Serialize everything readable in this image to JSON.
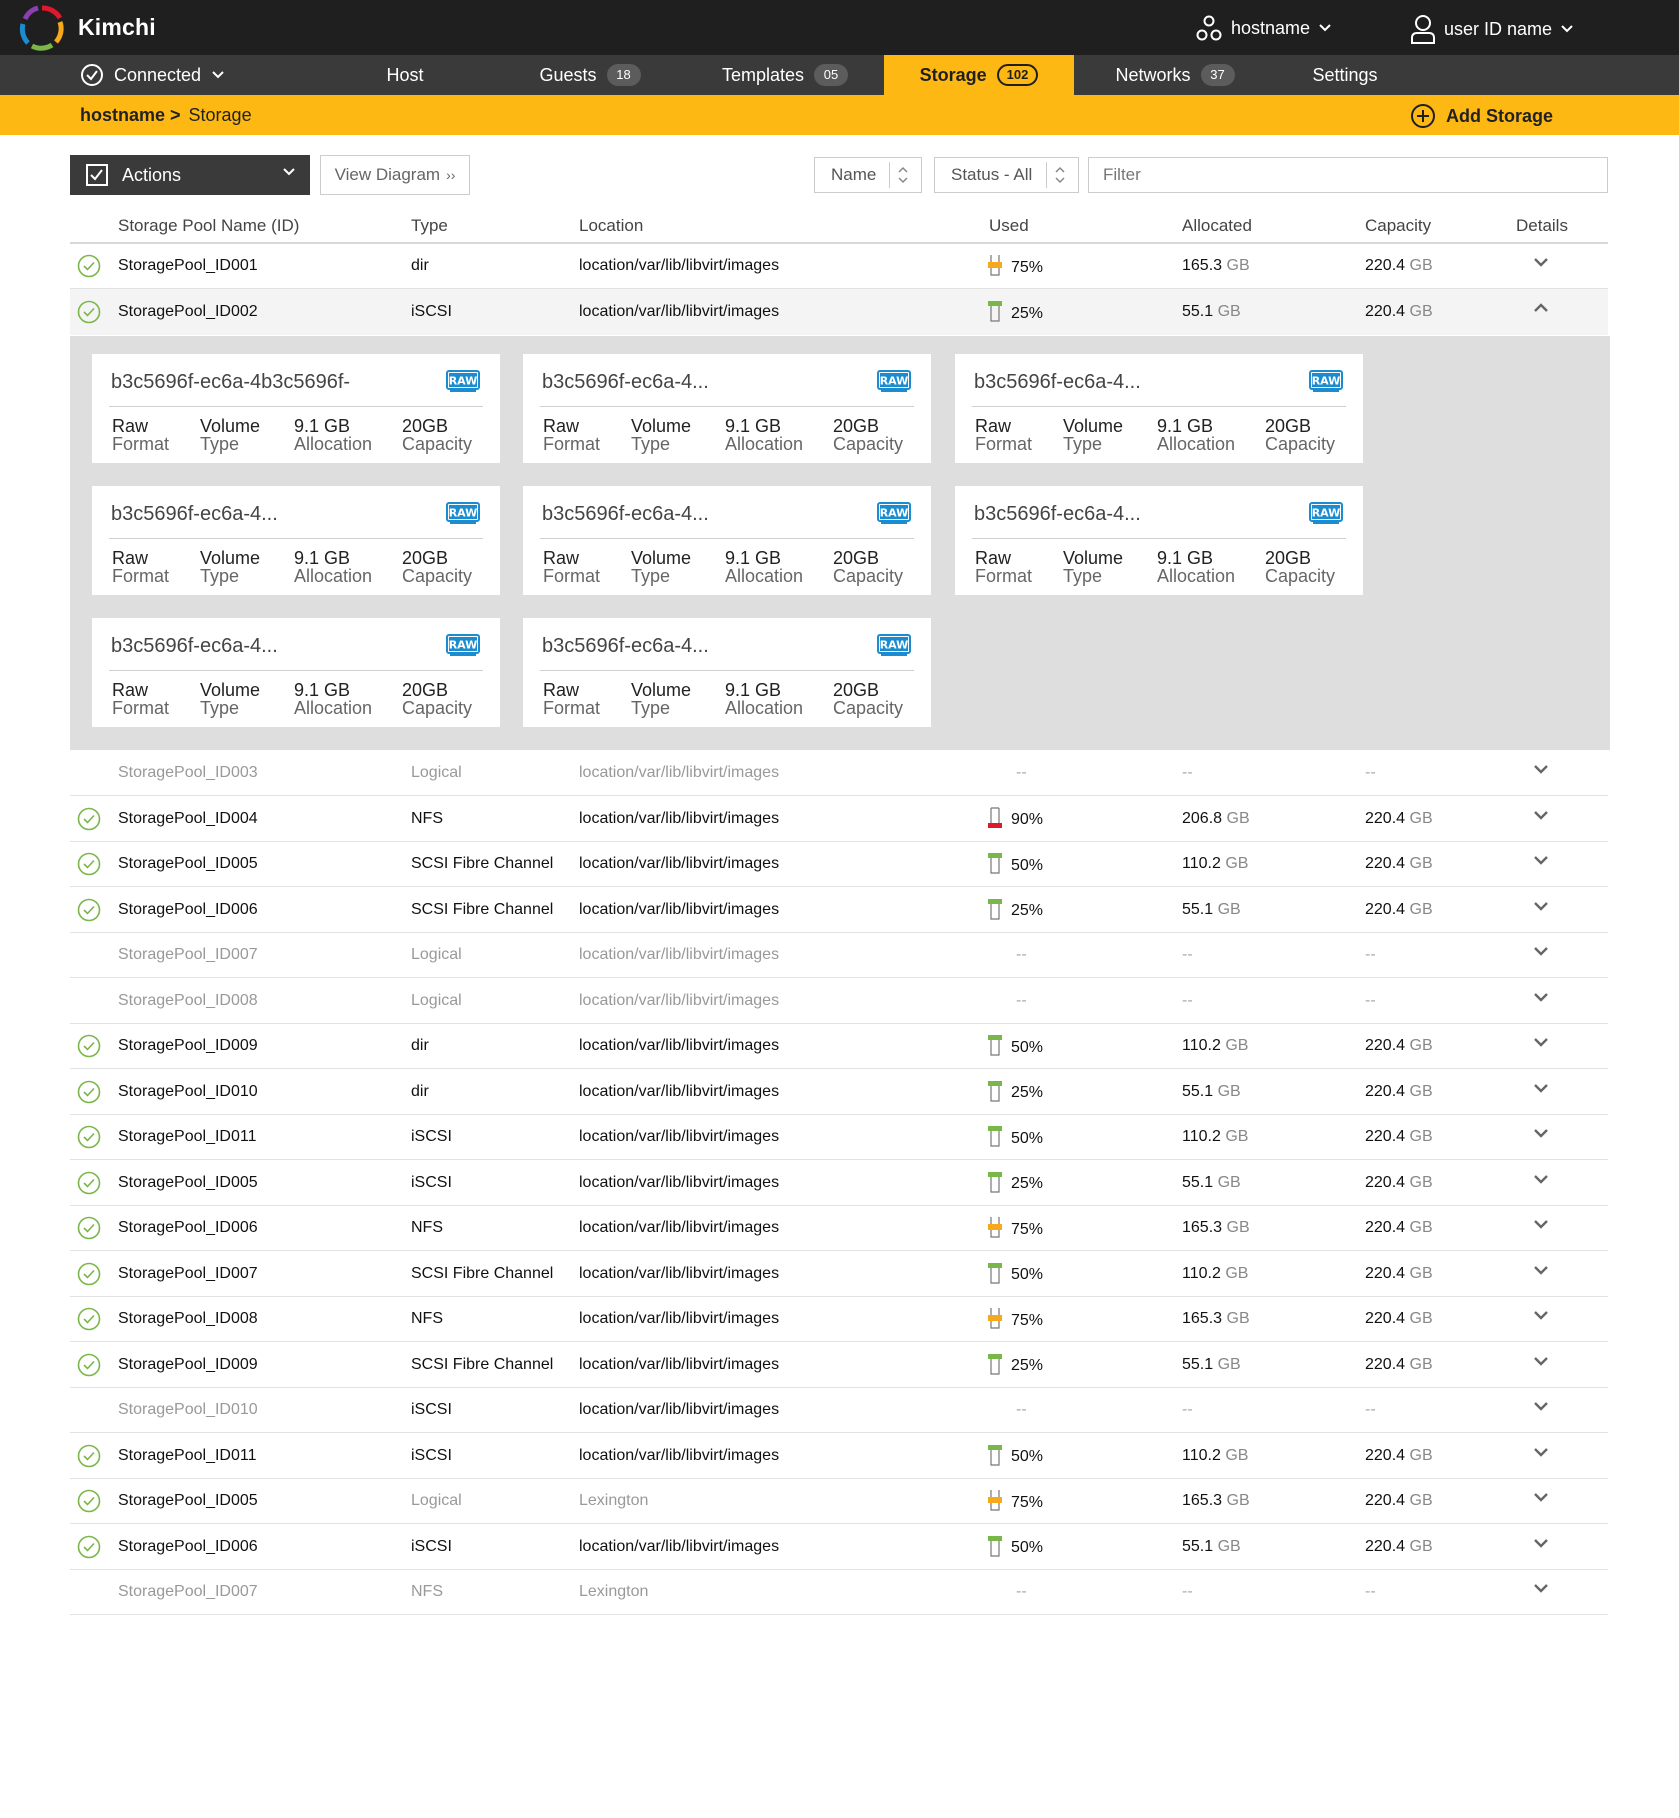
{
  "app": {
    "title": "Kimchi"
  },
  "header": {
    "host_label": "hostname",
    "user_label": "user ID name"
  },
  "nav": {
    "connection": "Connected",
    "tabs": [
      {
        "label": "Host",
        "count": ""
      },
      {
        "label": "Guests",
        "count": "18"
      },
      {
        "label": "Templates",
        "count": "05"
      },
      {
        "label": "Storage",
        "count": "102"
      },
      {
        "label": "Networks",
        "count": "37"
      },
      {
        "label": "Settings",
        "count": ""
      }
    ]
  },
  "breadcrumb": {
    "parent": "hostname >",
    "current": "Storage"
  },
  "add_storage_label": "Add Storage",
  "toolbar": {
    "actions_label": "Actions",
    "view_diagram_label": "View Diagram",
    "view_diagram_glyph": "››",
    "sort_label": "Name",
    "status_label": "Status - All",
    "filter_placeholder": "Filter"
  },
  "table": {
    "headers": [
      "Storage Pool Name (ID)",
      "Type",
      "Location",
      "Used",
      "Allocated",
      "Capacity",
      "Details"
    ],
    "rows": [
      {
        "name": "StoragePool_ID001",
        "type": "dir",
        "location": "location/var/lib/libvirt/images",
        "used": "75%",
        "used_level": "warning",
        "allocated": "165.3",
        "capacity": "220.4",
        "active": true,
        "expanded": false
      },
      {
        "name": "StoragePool_ID002",
        "type": "iSCSI",
        "location": "location/var/lib/libvirt/images",
        "used": "25%",
        "used_level": "ok",
        "allocated": "55.1",
        "capacity": "220.4",
        "active": true,
        "expanded": true
      },
      {
        "name": "StoragePool_ID003",
        "type": "Logical",
        "location": "location/var/lib/libvirt/images",
        "used": "--",
        "used_level": "none",
        "allocated": "--",
        "capacity": "--",
        "active": false,
        "expanded": false
      },
      {
        "name": "StoragePool_ID004",
        "type": "NFS",
        "location": "location/var/lib/libvirt/images",
        "used": "90%",
        "used_level": "critical",
        "allocated": "206.8",
        "capacity": "220.4",
        "active": true,
        "expanded": false
      },
      {
        "name": "StoragePool_ID005",
        "type": "SCSI Fibre Channel",
        "location": "location/var/lib/libvirt/images",
        "used": "50%",
        "used_level": "ok",
        "allocated": "110.2",
        "capacity": "220.4",
        "active": true,
        "expanded": false
      },
      {
        "name": "StoragePool_ID006",
        "type": "SCSI Fibre Channel",
        "location": "location/var/lib/libvirt/images",
        "used": "25%",
        "used_level": "ok",
        "allocated": "55.1",
        "capacity": "220.4",
        "active": true,
        "expanded": false
      },
      {
        "name": "StoragePool_ID007",
        "type": "Logical",
        "location": "location/var/lib/libvirt/images",
        "used": "--",
        "used_level": "none",
        "allocated": "--",
        "capacity": "--",
        "active": false,
        "expanded": false
      },
      {
        "name": "StoragePool_ID008",
        "type": "Logical",
        "location": "location/var/lib/libvirt/images",
        "used": "--",
        "used_level": "none",
        "allocated": "--",
        "capacity": "--",
        "active": false,
        "expanded": false
      },
      {
        "name": "StoragePool_ID009",
        "type": "dir",
        "location": "location/var/lib/libvirt/images",
        "used": "50%",
        "used_level": "ok",
        "allocated": "110.2",
        "capacity": "220.4",
        "active": true,
        "expanded": false
      },
      {
        "name": "StoragePool_ID010",
        "type": "dir",
        "location": "location/var/lib/libvirt/images",
        "used": "25%",
        "used_level": "ok",
        "allocated": "55.1",
        "capacity": "220.4",
        "active": true,
        "expanded": false
      },
      {
        "name": "StoragePool_ID011",
        "type": "iSCSI",
        "location": "location/var/lib/libvirt/images",
        "used": "50%",
        "used_level": "ok",
        "allocated": "110.2",
        "capacity": "220.4",
        "active": true,
        "expanded": false
      },
      {
        "name": "StoragePool_ID005",
        "type": "iSCSI",
        "location": "location/var/lib/libvirt/images",
        "used": "25%",
        "used_level": "ok",
        "allocated": "55.1",
        "capacity": "220.4",
        "active": true,
        "expanded": false
      },
      {
        "name": "StoragePool_ID006",
        "type": "NFS",
        "location": "location/var/lib/libvirt/images",
        "used": "75%",
        "used_level": "warning",
        "allocated": "165.3",
        "capacity": "220.4",
        "active": true,
        "expanded": false
      },
      {
        "name": "StoragePool_ID007",
        "type": "SCSI Fibre Channel",
        "location": "location/var/lib/libvirt/images",
        "used": "50%",
        "used_level": "ok",
        "allocated": "110.2",
        "capacity": "220.4",
        "active": true,
        "expanded": false
      },
      {
        "name": "StoragePool_ID008",
        "type": "NFS",
        "location": "location/var/lib/libvirt/images",
        "used": "75%",
        "used_level": "warning",
        "allocated": "165.3",
        "capacity": "220.4",
        "active": true,
        "expanded": false
      },
      {
        "name": "StoragePool_ID009",
        "type": "SCSI Fibre Channel",
        "location": "location/var/lib/libvirt/images",
        "used": "25%",
        "used_level": "ok",
        "allocated": "55.1",
        "capacity": "220.4",
        "active": true,
        "expanded": false
      },
      {
        "name": "StoragePool_ID010",
        "type": "iSCSI",
        "location": "location/var/lib/libvirt/images",
        "used": "--",
        "used_level": "none",
        "allocated": "--",
        "capacity": "--",
        "active": false,
        "expanded": false,
        "name_dim": true,
        "type_dim": false,
        "loc_dim": false
      },
      {
        "name": "StoragePool_ID011",
        "type": "iSCSI",
        "location": "location/var/lib/libvirt/images",
        "used": "50%",
        "used_level": "ok",
        "allocated": "110.2",
        "capacity": "220.4",
        "active": true,
        "expanded": false
      },
      {
        "name": "StoragePool_ID005",
        "type": "Logical",
        "location": "Lexington",
        "used": "75%",
        "used_level": "warning",
        "allocated": "165.3",
        "capacity": "220.4",
        "active": true,
        "expanded": false,
        "type_dim": true,
        "loc_dim": true
      },
      {
        "name": "StoragePool_ID006",
        "type": "iSCSI",
        "location": "location/var/lib/libvirt/images",
        "used": "50%",
        "used_level": "ok",
        "allocated": "55.1",
        "capacity": "220.4",
        "active": true,
        "expanded": false
      },
      {
        "name": "StoragePool_ID007",
        "type": "NFS",
        "location": "Lexington",
        "used": "--",
        "used_level": "none",
        "allocated": "--",
        "capacity": "--",
        "active": false,
        "expanded": false
      }
    ],
    "unit": "GB"
  },
  "volumes": {
    "badge": "RAW",
    "items": [
      {
        "title": "b3c5696f-ec6a-4b3c5696f-",
        "format_value": "Raw",
        "format_label": "Format",
        "type_value": "Volume",
        "type_label": "Type",
        "alloc_value": "9.1 GB",
        "alloc_label": "Allocation",
        "cap_value": "20GB",
        "cap_label": "Capacity"
      },
      {
        "title": "b3c5696f-ec6a-4...",
        "format_value": "Raw",
        "format_label": "Format",
        "type_value": "Volume",
        "type_label": "Type",
        "alloc_value": "9.1 GB",
        "alloc_label": "Allocation",
        "cap_value": "20GB",
        "cap_label": "Capacity"
      },
      {
        "title": "b3c5696f-ec6a-4...",
        "format_value": "Raw",
        "format_label": "Format",
        "type_value": "Volume",
        "type_label": "Type",
        "alloc_value": "9.1 GB",
        "alloc_label": "Allocation",
        "cap_value": "20GB",
        "cap_label": "Capacity"
      },
      {
        "title": "b3c5696f-ec6a-4...",
        "format_value": "Raw",
        "format_label": "Format",
        "type_value": "Volume",
        "type_label": "Type",
        "alloc_value": "9.1 GB",
        "alloc_label": "Allocation",
        "cap_value": "20GB",
        "cap_label": "Capacity"
      },
      {
        "title": "b3c5696f-ec6a-4...",
        "format_value": "Raw",
        "format_label": "Format",
        "type_value": "Volume",
        "type_label": "Type",
        "alloc_value": "9.1 GB",
        "alloc_label": "Allocation",
        "cap_value": "20GB",
        "cap_label": "Capacity"
      },
      {
        "title": "b3c5696f-ec6a-4...",
        "format_value": "Raw",
        "format_label": "Format",
        "type_value": "Volume",
        "type_label": "Type",
        "alloc_value": "9.1 GB",
        "alloc_label": "Allocation",
        "cap_value": "20GB",
        "cap_label": "Capacity"
      },
      {
        "title": "b3c5696f-ec6a-4...",
        "format_value": "Raw",
        "format_label": "Format",
        "type_value": "Volume",
        "type_label": "Type",
        "alloc_value": "9.1 GB",
        "alloc_label": "Allocation",
        "cap_value": "20GB",
        "cap_label": "Capacity"
      },
      {
        "title": "b3c5696f-ec6a-4...",
        "format_value": "Raw",
        "format_label": "Format",
        "type_value": "Volume",
        "type_label": "Type",
        "alloc_value": "9.1 GB",
        "alloc_label": "Allocation",
        "cap_value": "20GB",
        "cap_label": "Capacity"
      }
    ]
  },
  "colors": {
    "accent": "#fdb813",
    "ok": "#7ab648",
    "warning": "#f7a81b",
    "critical": "#e0182d",
    "dark": "#1f1f1f",
    "raw_badge": "#1a8ccf"
  },
  "icons": {
    "status_ok": "check-circle-icon",
    "details_expand": "chevron-down-icon",
    "details_collapse": "chevron-up-icon"
  }
}
